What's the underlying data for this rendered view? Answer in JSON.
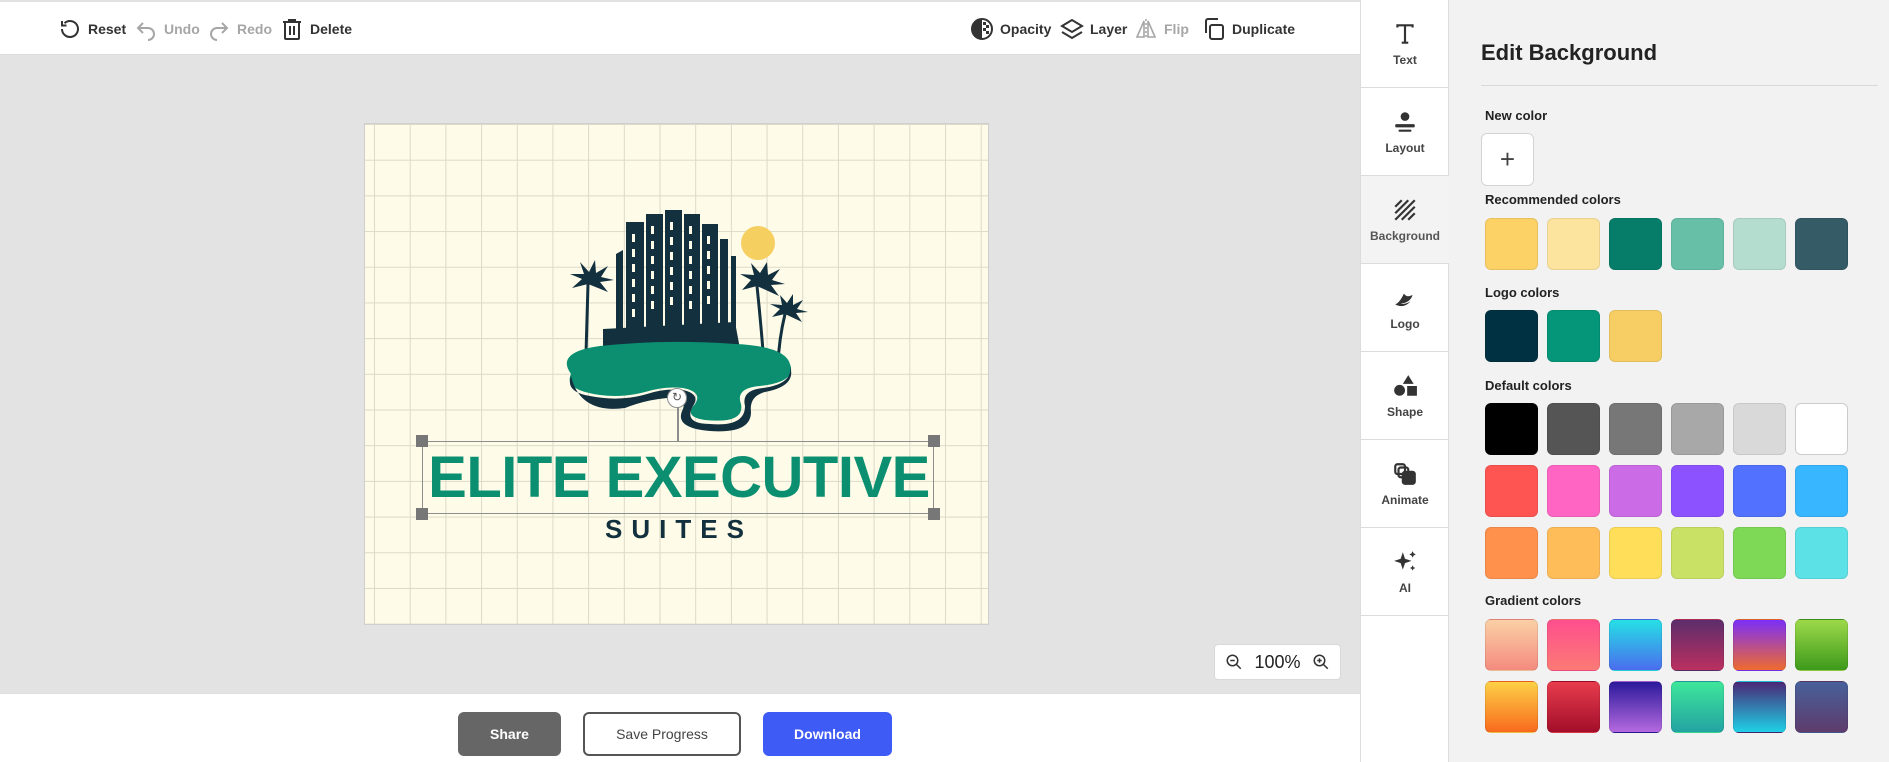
{
  "toolbar": {
    "reset": "Reset",
    "undo": "Undo",
    "redo": "Redo",
    "delete": "Delete",
    "opacity": "Opacity",
    "layer": "Layer",
    "flip": "Flip",
    "duplicate": "Duplicate"
  },
  "logo": {
    "title": "ELITE EXECUTIVE",
    "subtitle": "SUITES",
    "colors": {
      "teal": "#0b8f70",
      "navy": "#13303f",
      "sun": "#f5cf60",
      "background": "#fefce8"
    }
  },
  "zoom": {
    "value": "100%"
  },
  "bottom": {
    "share": "Share",
    "save": "Save Progress",
    "download": "Download"
  },
  "rail": {
    "items": [
      {
        "label": "Text",
        "icon": "text-icon"
      },
      {
        "label": "Layout",
        "icon": "layout-icon"
      },
      {
        "label": "Background",
        "icon": "background-icon",
        "active": true
      },
      {
        "label": "Logo",
        "icon": "logo-icon"
      },
      {
        "label": "Shape",
        "icon": "shape-icon"
      },
      {
        "label": "Animate",
        "icon": "animate-icon"
      },
      {
        "label": "AI",
        "icon": "ai-sparkle-icon"
      }
    ]
  },
  "panel": {
    "title": "Edit Background",
    "new_color_label": "New color",
    "new_color_button": "+",
    "recommended_label": "Recommended colors",
    "recommended": [
      "#fcd266",
      "#fde49e",
      "#067d69",
      "#68bfa8",
      "#b4ddd0",
      "#345b66"
    ],
    "logo_colors_label": "Logo colors",
    "logo_colors": [
      "#003142",
      "#05967a",
      "#f6ce63"
    ],
    "default_label": "Default colors",
    "default": [
      [
        "#000000",
        "#555555",
        "#777777",
        "#a8a8a8",
        "#d9d9d9",
        "#ffffff"
      ],
      [
        "#fe5553",
        "#ff66c4",
        "#cb6ce6",
        "#8c52ff",
        "#5271ff",
        "#38b6ff"
      ],
      [
        "#ff914d",
        "#ffbd59",
        "#ffde59",
        "#c9e265",
        "#7ed957",
        "#5ce1e6"
      ]
    ],
    "gradient_label": "Gradient colors",
    "gradients": [
      [
        "linear-gradient(#fad0a6,#f48b7e)",
        "linear-gradient(#fe4f8e,#fc7a75)",
        "linear-gradient(#26e0e5,#4a6dee)",
        "linear-gradient(#5c2d6b,#bb3060)",
        "linear-gradient(#7b2ff7,#ef6b2f)",
        "linear-gradient(#9dd94a,#3d9a1b)"
      ],
      [
        "linear-gradient(#fdd046,#f86a1d)",
        "linear-gradient(#e73c4d,#a30e2a)",
        "linear-gradient(#2b1a9b,#b569df)",
        "linear-gradient(#3ee69a,#23a3a2)",
        "linear-gradient(#4a2776,#1ed1e6)",
        "linear-gradient(#47609a,#5e3c6c)"
      ]
    ]
  }
}
